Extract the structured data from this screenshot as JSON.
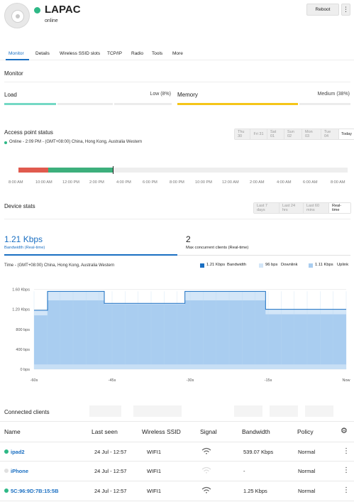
{
  "header": {
    "title": "LAPAC",
    "status": "online",
    "reboot_label": "Reboot",
    "more_label": "⋮"
  },
  "tabs": [
    {
      "label": "Monitor",
      "active": true
    },
    {
      "label": "Details"
    },
    {
      "label": "Wireless SSID slots"
    },
    {
      "label": "TCP/IP"
    },
    {
      "label": "Radio"
    },
    {
      "label": "Tools"
    },
    {
      "label": "More"
    }
  ],
  "monitor": {
    "title": "Monitor",
    "load": {
      "label": "Load",
      "value": "Low (8%)",
      "percent": 8
    },
    "memory": {
      "label": "Memory",
      "value": "Medium (38%)",
      "percent": 38
    }
  },
  "ap_status": {
    "title": "Access point status",
    "days": [
      "Thu 30",
      "Fri 31",
      "Sat 01",
      "Sun 02",
      "Mon 03",
      "Tue 04",
      "Today"
    ],
    "selected_day": "Today",
    "status_line": "Online - 2:09 PM - (GMT+08:00) China, Hong Kong, Australia Western",
    "time_ticks": [
      "8:00 AM",
      "10:00 AM",
      "12:00 PM",
      "2:00 PM",
      "4:00 PM",
      "6:00 PM",
      "8:00 PM",
      "10:00 PM",
      "12:00 AM",
      "2:00 AM",
      "4:00 AM",
      "6:00 AM",
      "8:00 AM"
    ]
  },
  "device_stats": {
    "title": "Device stats",
    "ranges": [
      "Last 7 days",
      "Last 24 hrs",
      "Last 60 mins",
      "Real-time"
    ],
    "selected_range": "Real-time",
    "bandwidth_value": "1.21 Kbps",
    "bandwidth_label": "Bandwidth (Real-time)",
    "clients_value": "2",
    "clients_label": "Max concurrent clients (Real-time)",
    "timezone": "Time - (GMT+08:00) China, Hong Kong, Australia Western",
    "legend": [
      {
        "value": "1.21 Kbps",
        "name": "Bandwidth",
        "color": "#1a6fc2"
      },
      {
        "value": "96 bps",
        "name": "Downlink",
        "color": "#d3e6f8"
      },
      {
        "value": "1.11 Kbps",
        "name": "Uplink",
        "color": "#a9cdf0"
      }
    ]
  },
  "chart_data": {
    "type": "area",
    "x": [
      "-60s",
      "-45s",
      "-30s",
      "-15s",
      "Now"
    ],
    "y_ticks": [
      "0 bps",
      "400 bps",
      "800 bps",
      "1.20 Kbps",
      "1.60 Kbps"
    ],
    "ylim": [
      0,
      1650
    ],
    "xlim": [
      -60,
      0
    ],
    "series": [
      {
        "name": "Uplink",
        "points": [
          [
            -60,
            1080
          ],
          [
            -57.4,
            1080
          ],
          [
            -57.4,
            1380
          ],
          [
            -46.5,
            1380
          ],
          [
            -46.5,
            1300
          ],
          [
            -31,
            1300
          ],
          [
            -31,
            1380
          ],
          [
            -15.5,
            1380
          ],
          [
            -15.5,
            1100
          ],
          [
            0,
            1100
          ]
        ]
      },
      {
        "name": "Downlink",
        "points": [
          [
            -60,
            96
          ],
          [
            0,
            96
          ]
        ]
      },
      {
        "name": "Bandwidth",
        "points": [
          [
            -60,
            1180
          ],
          [
            -57.4,
            1180
          ],
          [
            -57.4,
            1560
          ],
          [
            -46.5,
            1560
          ],
          [
            -46.5,
            1320
          ],
          [
            -31,
            1320
          ],
          [
            -31,
            1560
          ],
          [
            -15.5,
            1560
          ],
          [
            -15.5,
            1200
          ],
          [
            0,
            1200
          ]
        ]
      }
    ]
  },
  "clients": {
    "title": "Connected clients",
    "columns": [
      "Name",
      "Last seen",
      "Wireless SSID",
      "Signal",
      "Bandwidth",
      "Policy"
    ],
    "rows": [
      {
        "name": "ipad2",
        "last_seen": "24 Jul - 12:57",
        "ssid": "WIFI1",
        "bandwidth": "539.07 Kbps",
        "policy": "Normal",
        "online": true
      },
      {
        "name": "iPhone",
        "last_seen": "24 Jul - 12:57",
        "ssid": "WIFI1",
        "bandwidth": "-",
        "policy": "Normal",
        "online": false
      },
      {
        "name": "5C:96:9D:7B:15:5B",
        "last_seen": "24 Jul - 12:57",
        "ssid": "WIFI1",
        "bandwidth": "1.25 Kbps",
        "policy": "Normal",
        "online": true
      }
    ]
  },
  "colors": {
    "accent": "#1a6fc2",
    "online": "#2eb886",
    "load_bar": "#74d8c4",
    "memory_bar": "#f5c518",
    "offline_segment": "#e05a4e"
  }
}
